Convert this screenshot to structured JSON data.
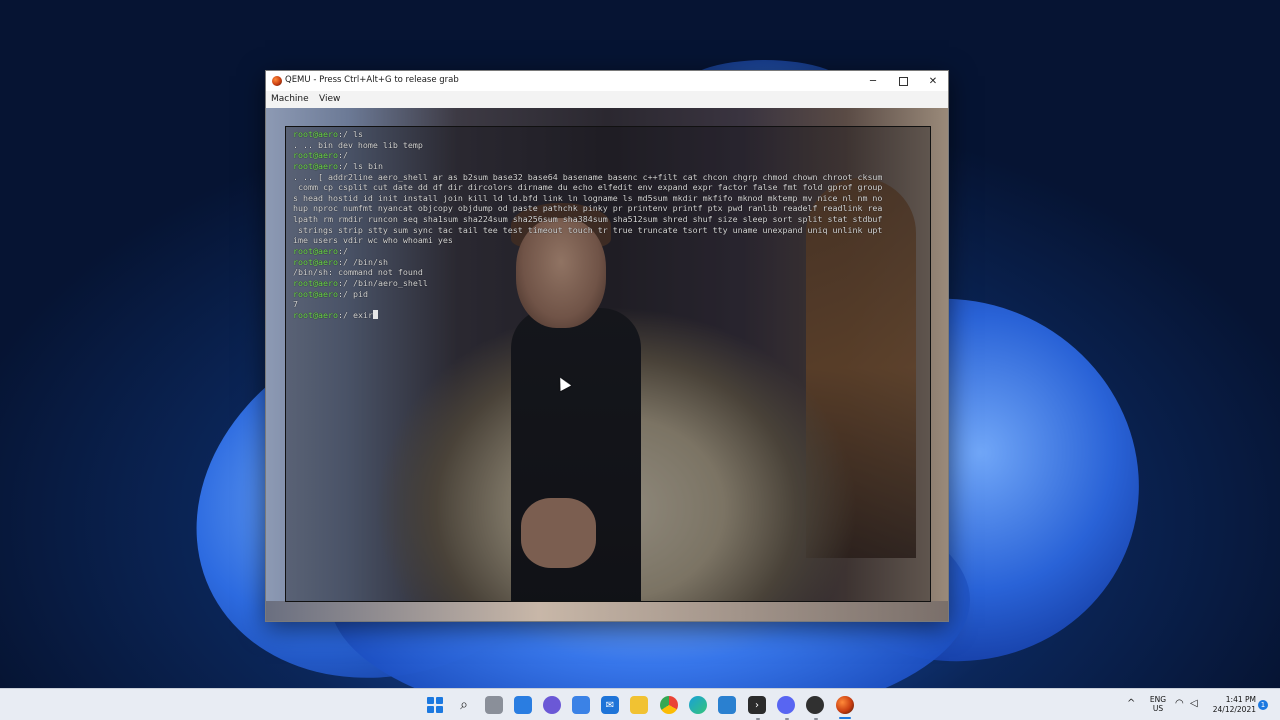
{
  "window": {
    "title": "QEMU - Press Ctrl+Alt+G to release grab",
    "controls": {
      "minimize": "─",
      "close": "✕"
    },
    "menu": [
      "Machine",
      "View"
    ]
  },
  "terminal": {
    "lines": [
      {
        "prompt": "root@aero",
        "suffix": ":/ ",
        "text": "ls"
      },
      {
        "prompt": "",
        "suffix": "",
        "text": ". .. bin dev home lib temp"
      },
      {
        "prompt": "root@aero",
        "suffix": ":/ ",
        "text": ""
      },
      {
        "prompt": "root@aero",
        "suffix": ":/ ",
        "text": "ls bin"
      },
      {
        "prompt": "",
        "suffix": "",
        "text": ". .. [ addr2line aero_shell ar as b2sum base32 base64 basename basenc c++filt cat chcon chgrp chmod chown chroot cksum"
      },
      {
        "prompt": "",
        "suffix": "",
        "text": " comm cp csplit cut date dd df dir dircolors dirname du echo elfedit env expand expr factor false fmt fold gprof group"
      },
      {
        "prompt": "",
        "suffix": "",
        "text": "s head hostid id init install join kill ld ld.bfd link ln logname ls md5sum mkdir mkfifo mknod mktemp mv nice nl nm no"
      },
      {
        "prompt": "",
        "suffix": "",
        "text": "hup nproc numfmt nyancat objcopy objdump od paste pathchk pinky pr printenv printf ptx pwd ranlib readelf readlink rea"
      },
      {
        "prompt": "",
        "suffix": "",
        "text": "lpath rm rmdir runcon seq sha1sum sha224sum sha256sum sha384sum sha512sum shred shuf size sleep sort split stat stdbuf"
      },
      {
        "prompt": "",
        "suffix": "",
        "text": " strings strip stty sum sync tac tail tee test timeout touch tr true truncate tsort tty uname unexpand uniq unlink upt"
      },
      {
        "prompt": "",
        "suffix": "",
        "text": "ime users vdir wc who whoami yes"
      },
      {
        "prompt": "root@aero",
        "suffix": ":/ ",
        "text": ""
      },
      {
        "prompt": "root@aero",
        "suffix": ":/ ",
        "text": "/bin/sh"
      },
      {
        "prompt": "",
        "suffix": "",
        "text": "/bin/sh: command not found"
      },
      {
        "prompt": "root@aero",
        "suffix": ":/ ",
        "text": "/bin/aero_shell"
      },
      {
        "prompt": "root@aero",
        "suffix": ":/ ",
        "text": "pid"
      },
      {
        "prompt": "",
        "suffix": "",
        "text": "7"
      },
      {
        "prompt": "root@aero",
        "suffix": ":/ ",
        "text": "exir"
      }
    ],
    "colors": {
      "prompt": "#6fdc4a",
      "text": "#d6d6d6"
    }
  },
  "taskbar": {
    "apps": [
      "start-icon",
      "search-icon",
      "task-view-icon",
      "widgets-icon",
      "chat-icon",
      "store-icon",
      "mail-icon",
      "file-explorer-icon",
      "chrome-icon",
      "edge-icon",
      "vscode-icon",
      "terminal-icon",
      "discord-icon",
      "obs-icon",
      "qemu-icon"
    ],
    "tray": {
      "chevron": "^",
      "lang_line1": "ENG",
      "lang_line2": "US",
      "time": "1:41 PM",
      "date": "24/12/2021",
      "notifications": "1"
    }
  }
}
